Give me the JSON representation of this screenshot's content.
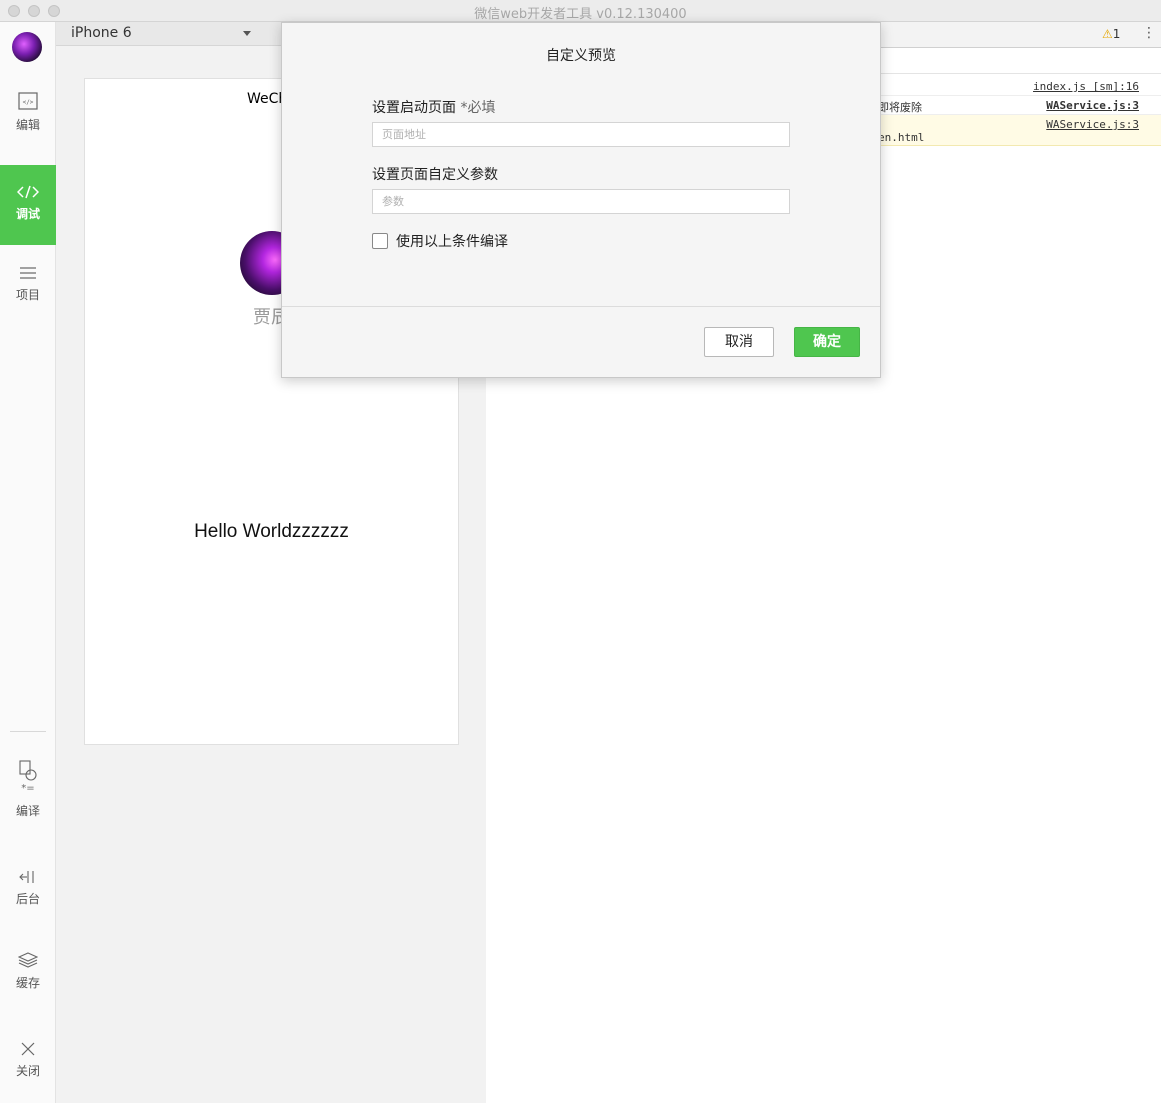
{
  "window": {
    "title": "微信web开发者工具 v0.12.130400"
  },
  "sidebar": {
    "items": [
      {
        "label": "编辑",
        "icon": "code-square-icon"
      },
      {
        "label": "调试",
        "icon": "code-brackets-icon",
        "active": true
      },
      {
        "label": "项目",
        "icon": "menu-lines-icon"
      },
      {
        "label": "编译",
        "icon": "compile-icon",
        "sublabel": "*="
      },
      {
        "label": "后台",
        "icon": "background-icon"
      },
      {
        "label": "缓存",
        "icon": "layers-icon"
      },
      {
        "label": "关闭",
        "icon": "close-icon"
      }
    ],
    "accent": "#4fc64f"
  },
  "simulator": {
    "device": "iPhone 6",
    "page": {
      "nav_title": "WeCh",
      "nickname": "贾辰",
      "hello": "Hello Worldzzzzzz"
    }
  },
  "devtools": {
    "warning_count": "1",
    "logs": [
      {
        "message": "",
        "source": "index.js [sm]:16"
      },
      {
        "message": "即将废除",
        "source": "WAService.js:3"
      },
      {
        "message": "en.html",
        "source": "WAService.js:3",
        "level": "warning"
      }
    ]
  },
  "dialog": {
    "title": "自定义预览",
    "start_page_label": "设置启动页面",
    "start_page_required": "*必填",
    "start_page_placeholder": "页面地址",
    "params_label": "设置页面自定义参数",
    "params_placeholder": "参数",
    "compile_checkbox_label": "使用以上条件编译",
    "compile_checked": false,
    "cancel_label": "取消",
    "ok_label": "确定"
  }
}
